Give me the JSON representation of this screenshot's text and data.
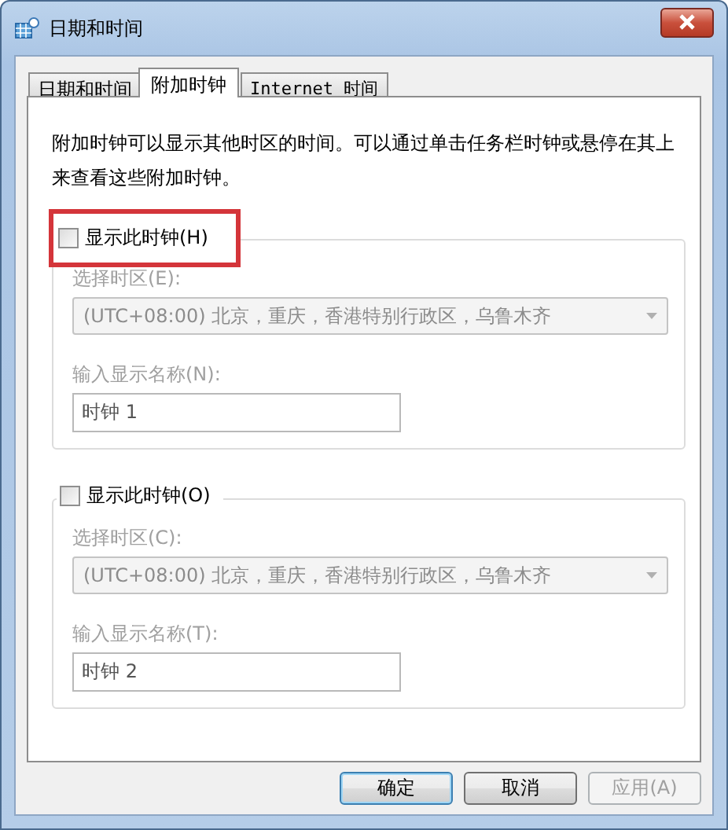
{
  "window": {
    "title": "日期和时间"
  },
  "tabs": [
    {
      "label": "日期和时间",
      "selected": false
    },
    {
      "label": "附加时钟",
      "selected": true
    },
    {
      "label": "Internet 时间",
      "selected": false
    }
  ],
  "description": "附加时钟可以显示其他时区的时间。可以通过单击任务栏时钟或悬停在其上来查看这些附加时钟。",
  "clocks": [
    {
      "show_label": "显示此时钟(H)",
      "checked": false,
      "highlighted": true,
      "timezone_label": "选择时区(E):",
      "timezone": "(UTC+08:00) 北京，重庆，香港特别行政区，乌鲁木齐",
      "name_label": "输入显示名称(N):",
      "name_value": "时钟 1"
    },
    {
      "show_label": "显示此时钟(O)",
      "checked": false,
      "highlighted": false,
      "timezone_label": "选择时区(C):",
      "timezone": "(UTC+08:00) 北京，重庆，香港特别行政区，乌鲁木齐",
      "name_label": "输入显示名称(T):",
      "name_value": "时钟 2"
    }
  ],
  "buttons": [
    {
      "label": "确定",
      "disabled": false
    },
    {
      "label": "取消",
      "disabled": false
    },
    {
      "label": "应用(A)",
      "disabled": true
    }
  ]
}
